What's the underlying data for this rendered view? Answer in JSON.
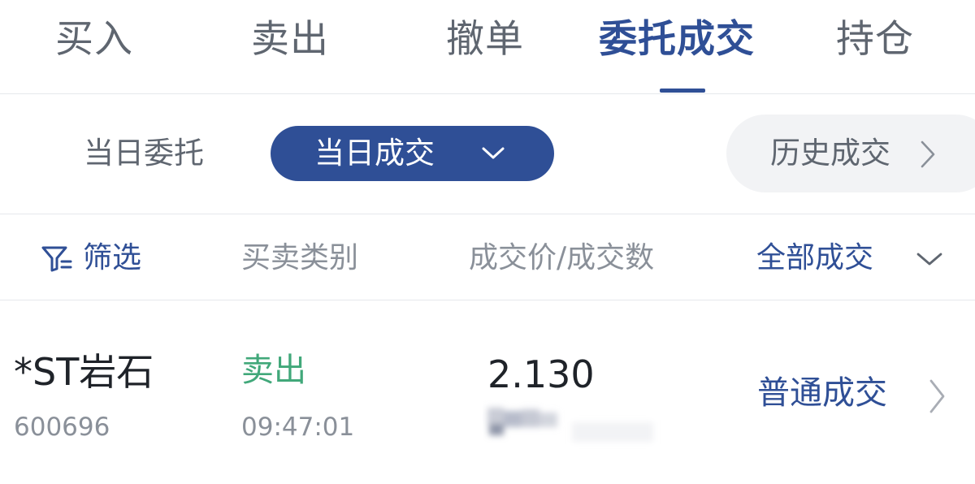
{
  "tabs": [
    {
      "label": "买入",
      "active": false
    },
    {
      "label": "卖出",
      "active": false
    },
    {
      "label": "撤单",
      "active": false
    },
    {
      "label": "委托成交",
      "active": true
    },
    {
      "label": "持仓",
      "active": false
    }
  ],
  "subtabs": {
    "today_orders": "当日委托",
    "today_trades": "当日成交",
    "history_trades": "历史成交"
  },
  "columns": {
    "filter": "筛选",
    "type": "买卖类别",
    "price_qty": "成交价/成交数",
    "all_trades": "全部成交"
  },
  "trades": [
    {
      "name": "*ST岩石",
      "code": "600696",
      "side": "卖出",
      "time": "09:47:01",
      "price": "2.130",
      "deal_type": "普通成交"
    }
  ],
  "colors": {
    "accent": "#2f4f96",
    "sell": "#41a87a",
    "muted": "#8a9099"
  },
  "icons": [
    "chevron-down-icon",
    "chevron-right-icon",
    "filter-icon"
  ]
}
